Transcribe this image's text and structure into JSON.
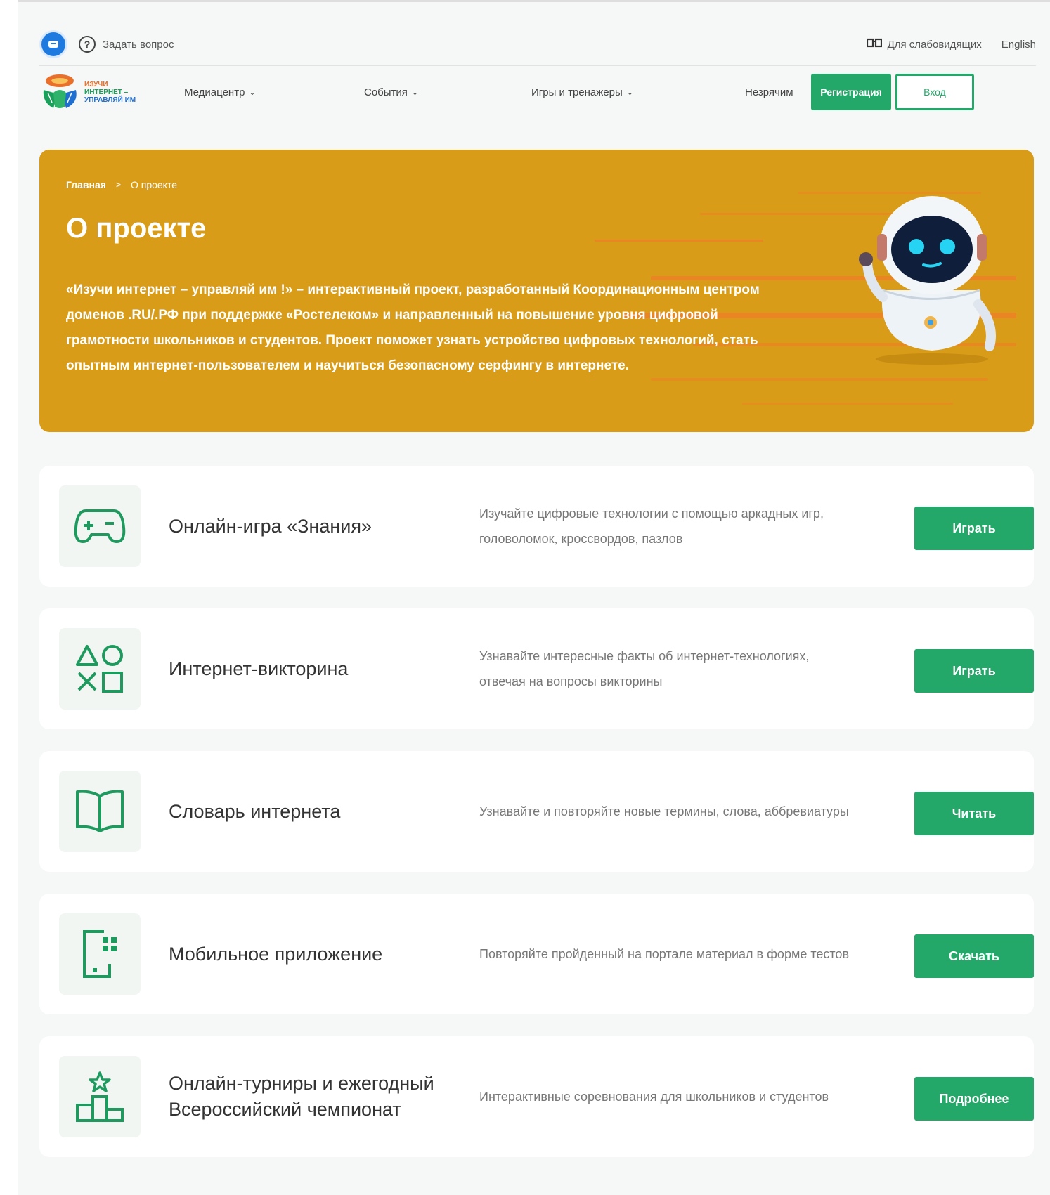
{
  "topbar": {
    "ask_label": "Задать вопрос",
    "vision_label": "Для слабовидящих",
    "lang_label": "English"
  },
  "logo": {
    "line1": "Изучи",
    "line2": "интернет –",
    "line3": "управляй им"
  },
  "nav": {
    "items": [
      {
        "label": "Медиацентр"
      },
      {
        "label": "События"
      },
      {
        "label": "Игры и тренажеры"
      },
      {
        "label": "Незрячим"
      }
    ],
    "register_label": "Регистрация",
    "login_label": "Вход"
  },
  "hero": {
    "breadcrumb": [
      "Главная",
      "О проекте"
    ],
    "breadcrumb_separator": ">",
    "title": "О проекте",
    "text": "«Изучи интернет – управляй им !» – интерактивный проект, разработанный Координационным центром доменов .RU/.РФ при поддержке «Ростелеком» и направленный на повышение уровня цифровой грамотности школьников и студентов. Проект поможет узнать устройство цифровых технологий, стать опытным интернет-пользователем и научиться безопасному серфингу в интернете."
  },
  "cards": [
    {
      "icon": "gamepad-icon",
      "title": "Онлайн-игра «Знания»",
      "desc": "Изучайте цифровые технологии с помощью аркадных игр, головоломок, кроссвордов, пазлов",
      "button": "Играть"
    },
    {
      "icon": "shapes-icon",
      "title": "Интернет-викторина",
      "desc": "Узнавайте интересные факты об интернет-технологиях, отвечая на вопросы викторины",
      "button": "Играть"
    },
    {
      "icon": "book-icon",
      "title": "Словарь интернета",
      "desc": "Узнавайте и повторяйте новые термины, слова, аббревиатуры",
      "button": "Читать"
    },
    {
      "icon": "mobile-app-icon",
      "title": "Мобильное приложение",
      "desc": "Повторяйте пройденный на портале материал в форме тестов",
      "button": "Скачать"
    },
    {
      "icon": "podium-icon",
      "title": "Онлайн-турниры и ежегодный Всероссийский чемпионат",
      "desc": "Интерактивные соревнования для школьников и студентов",
      "button": "Подробнее"
    }
  ],
  "colors": {
    "accent_green": "#23a86a",
    "hero_bg": "#d99c18",
    "hero_streak": "#e98522",
    "page_bg": "#f6f7f7"
  }
}
